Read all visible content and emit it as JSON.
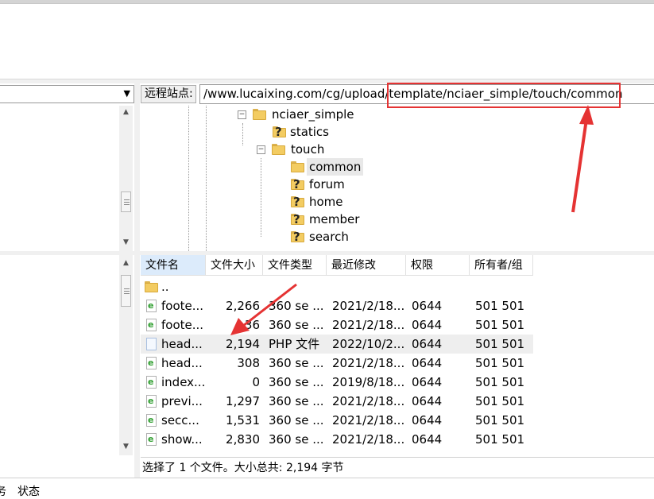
{
  "remote": {
    "label": "远程站点:",
    "path": "/www.lucaixing.com/cg/upload/template/nciaer_simple/touch/common"
  },
  "tree": [
    {
      "name": "nciaer_simple",
      "expander": "−"
    },
    {
      "name": "statics",
      "icon": "folder-unknown"
    },
    {
      "name": "touch",
      "expander": "−"
    },
    {
      "name": "common",
      "selected": true
    },
    {
      "name": "forum",
      "icon": "folder-unknown"
    },
    {
      "name": "home",
      "icon": "folder-unknown"
    },
    {
      "name": "member",
      "icon": "folder-unknown"
    },
    {
      "name": "search",
      "icon": "folder-unknown"
    }
  ],
  "columns": [
    "文件名",
    "文件大小",
    "文件类型",
    "最近修改",
    "权限",
    "所有者/组"
  ],
  "files": [
    {
      "name": "..",
      "size": "",
      "type": "",
      "modified": "",
      "perms": "",
      "owner": "",
      "icon": "folder"
    },
    {
      "name": "foote...",
      "size": "2,266",
      "type": "360 se ...",
      "modified": "2021/2/18...",
      "perms": "0644",
      "owner": "501 501",
      "icon": "html"
    },
    {
      "name": "foote...",
      "size": "36",
      "type": "360 se ...",
      "modified": "2021/2/18...",
      "perms": "0644",
      "owner": "501 501",
      "icon": "html"
    },
    {
      "name": "head...",
      "size": "2,194",
      "type": "PHP 文件",
      "modified": "2022/10/2...",
      "perms": "0644",
      "owner": "501 501",
      "icon": "php",
      "selected": true
    },
    {
      "name": "head...",
      "size": "308",
      "type": "360 se ...",
      "modified": "2021/2/18...",
      "perms": "0644",
      "owner": "501 501",
      "icon": "html"
    },
    {
      "name": "index...",
      "size": "0",
      "type": "360 se ...",
      "modified": "2019/8/18...",
      "perms": "0644",
      "owner": "501 501",
      "icon": "html"
    },
    {
      "name": "previ...",
      "size": "1,297",
      "type": "360 se ...",
      "modified": "2021/2/18...",
      "perms": "0644",
      "owner": "501 501",
      "icon": "html"
    },
    {
      "name": "secc...",
      "size": "1,531",
      "type": "360 se ...",
      "modified": "2021/2/18...",
      "perms": "0644",
      "owner": "501 501",
      "icon": "html"
    },
    {
      "name": "show...",
      "size": "2,830",
      "type": "360 se ...",
      "modified": "2021/2/18...",
      "perms": "0644",
      "owner": "501 501",
      "icon": "html"
    }
  ],
  "status": "选择了 1 个文件。大小总共: 2,194 字节",
  "bottom": {
    "left": "务",
    "right": "状态"
  },
  "colors": {
    "annotation_red": "#e53333",
    "selected_row": "#eeeeee",
    "sorted_header": "#dcebfb"
  }
}
